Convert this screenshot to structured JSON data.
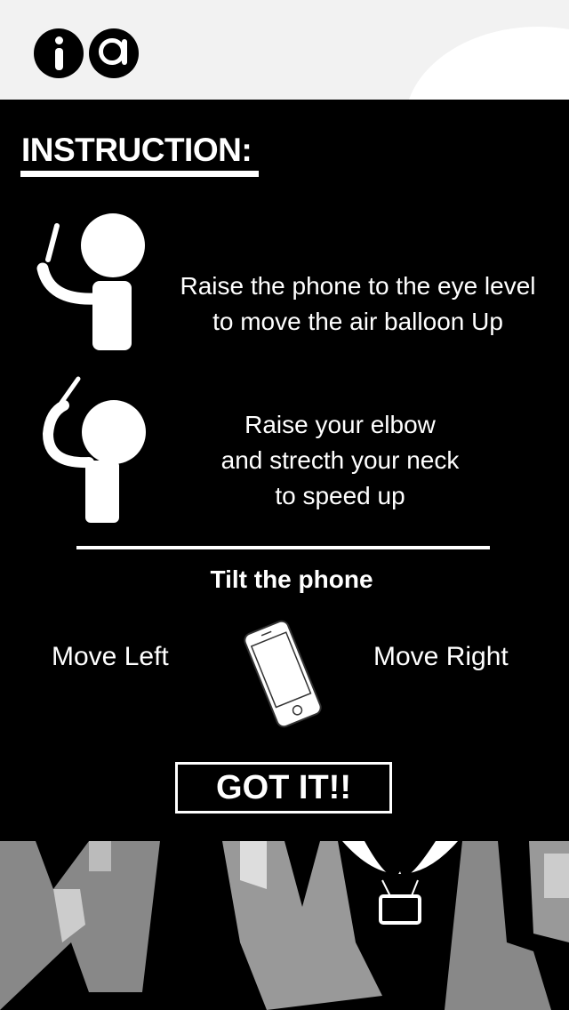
{
  "app": {
    "logo_left": "i",
    "logo_right": "a"
  },
  "instructions": {
    "heading": "INSTRUCTION:",
    "step1_line1": "Raise the phone to the eye level",
    "step1_line2": "to move the air balloon Up",
    "step2_line1": "Raise your elbow",
    "step2_line2": "and strecth your neck",
    "step2_line3": "to speed up"
  },
  "tilt": {
    "title": "Tilt the phone",
    "left_label": "Move Left",
    "right_label": "Move Right"
  },
  "actions": {
    "got_it_label": "GOT IT!!"
  },
  "colors": {
    "background": "#000000",
    "topbar": "#f2f2f2",
    "foreground": "#ffffff"
  }
}
